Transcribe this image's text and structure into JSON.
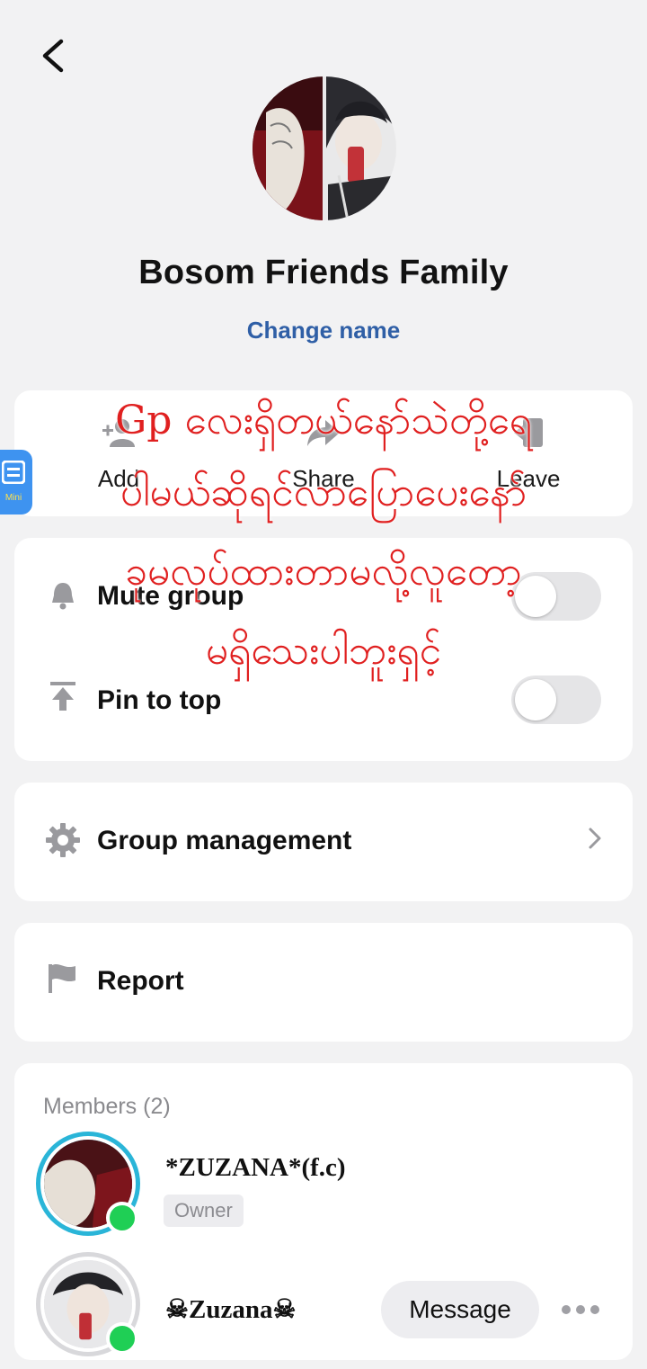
{
  "header": {
    "back_icon": "chevron-left-icon",
    "group_name": "Bosom Friends Family",
    "change_name_label": "Change name"
  },
  "actions": [
    {
      "label": "Add",
      "icon": "add-person-icon"
    },
    {
      "label": "Share",
      "icon": "share-arrow-icon"
    },
    {
      "label": "Leave",
      "icon": "leave-door-icon"
    }
  ],
  "settings": {
    "mute_label": "Mute group",
    "mute_on": false,
    "pin_label": "Pin to top",
    "pin_on": false,
    "management_label": "Group management",
    "report_label": "Report"
  },
  "members": {
    "heading": "Members (2)",
    "list": [
      {
        "name": "*ZUZANA*(f.c)",
        "badge": "Owner",
        "online": true
      },
      {
        "name": "☠Zuzana☠",
        "message_label": "Message",
        "online": true
      }
    ]
  },
  "overlay": {
    "line1": "Gp လေးရှိတယ်နော်သဲတို့ရေ",
    "line2": "ပါမယ်ဆိုရင်လာပြောပေးနော်",
    "line3": "ခုမလုပ်ထားတာမလို့လူတော့",
    "line4": "မရှိသေးပါဘူးရှင့်"
  },
  "mini_widget_label": "Mini",
  "colors": {
    "background": "#f2f2f3",
    "link": "#2f5fa6",
    "online": "#1fcf55",
    "overlay_text": "#e02020",
    "ring": "#2ab5d8"
  }
}
